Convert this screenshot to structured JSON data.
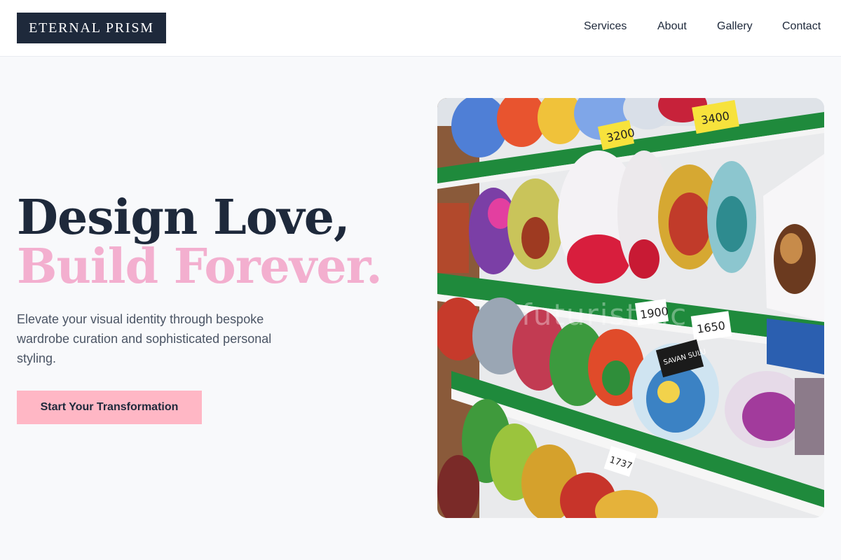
{
  "header": {
    "logo_text": "ETERNAL PRISM",
    "nav": [
      "Services",
      "About",
      "Gallery",
      "Contact"
    ]
  },
  "hero": {
    "headline_line1": "Design Love,",
    "headline_line2": "Build Forever.",
    "subtext": "Elevate your visual identity through bespoke wardrobe curation and sophisticated personal styling.",
    "cta_label": "Start Your Transformation",
    "image": {
      "subject": "supermarket shelves stocked with colorful bagged candy",
      "price_tags": [
        "3200",
        "3400",
        "1900",
        "1650",
        "1737"
      ],
      "label_text": "SAVAN SULU",
      "watermark": "futurist .lc"
    }
  },
  "colors": {
    "navy": "#1e293b",
    "pink_accent": "#f3afcf",
    "button_pink": "#ffb7c5",
    "page_bg": "#f8f9fb",
    "shelf_green": "#1f8a3c"
  }
}
